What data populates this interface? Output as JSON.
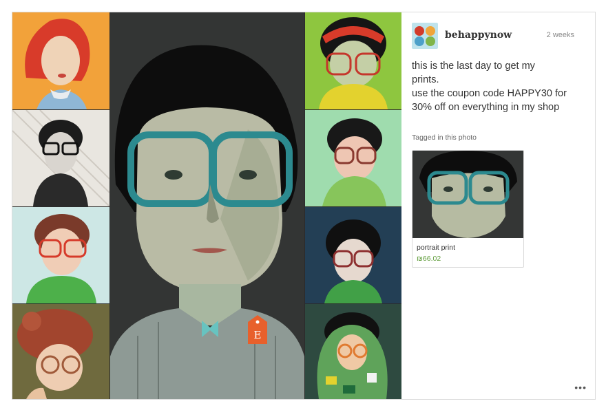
{
  "post": {
    "username": "behappynow",
    "time": "2 weeks",
    "caption_lines": [
      "this is the last day to get my",
      "prints.",
      "use the coupon code HAPPY30 for",
      "30% off on everything in my shop"
    ],
    "tagged_label": "Tagged in this photo",
    "tagged_item": {
      "title": "portrait print",
      "price": "₪66.02"
    },
    "more_label": "•••",
    "etsy_badge": "E"
  },
  "icons": {
    "etsy_tag": "etsy-price-tag-icon",
    "more": "more-options-icon"
  },
  "colors": {
    "accent_orange": "#e8602c",
    "price_green": "#5f9c3a",
    "border": "#dcdcdc"
  }
}
